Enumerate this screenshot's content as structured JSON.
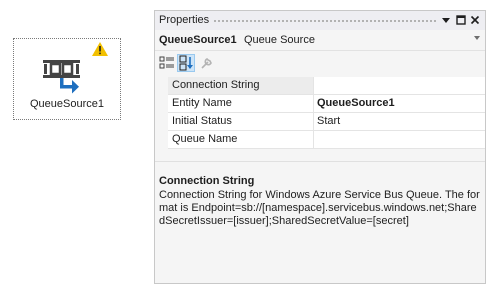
{
  "designer": {
    "component_label": "QueueSource1",
    "colors": {
      "warning": "#f2c000",
      "icon_dark": "#444444",
      "arrow": "#1e6fbf"
    }
  },
  "properties": {
    "window_title": "Properties",
    "object_name": "QueueSource1",
    "object_type": "Queue Source",
    "rows": [
      {
        "name": "Connection String",
        "value": "",
        "bold": false
      },
      {
        "name": "Entity Name",
        "value": "QueueSource1",
        "bold": true
      },
      {
        "name": "Initial Status",
        "value": "Start",
        "bold": false
      },
      {
        "name": "Queue Name",
        "value": "",
        "bold": false
      }
    ],
    "description": {
      "title": "Connection String",
      "text": "Connection String for Windows Azure Service Bus Queue. The format is Endpoint=sb://[namespace].servicebus.windows.net;SharedSecretIssuer=[issuer];SharedSecretValue=[secret]"
    }
  }
}
